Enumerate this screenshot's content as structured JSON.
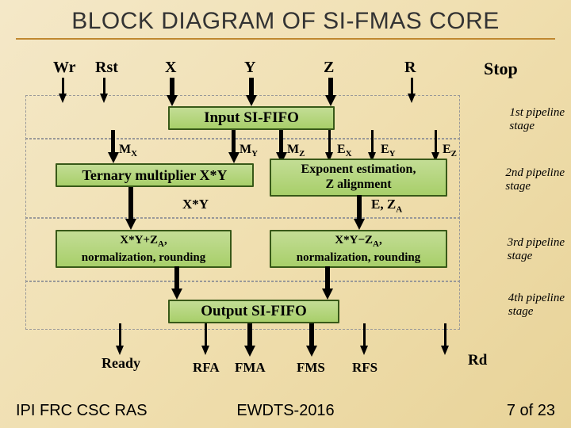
{
  "title": "BLOCK DIAGRAM OF SI-FMAS CORE",
  "inputs": {
    "wr": "Wr",
    "rst": "Rst",
    "x": "X",
    "y": "Y",
    "z": "Z",
    "r": "R",
    "stop": "Stop"
  },
  "blocks": {
    "input_fifo": "Input SI-FIFO",
    "ternary": "Ternary multiplier X*Y",
    "exp": "Exponent estimation,\nZ alignment",
    "addnorm": "X*Y+ZA,\nnormalization, rounding",
    "subnorm": "X*Y−ZA,\nnormalization, rounding",
    "output_fifo": "Output SI-FIFO"
  },
  "mids": {
    "mx": "MX",
    "my": "MY",
    "mz": "MZ",
    "ex": "EX",
    "ey": "EY",
    "ez": "EZ",
    "xy": "X*Y",
    "eza": "E, ZA"
  },
  "stages": {
    "s1": "1st pipeline\nstage",
    "s2": "2nd pipeline\nstage",
    "s3": "3rd pipeline\nstage",
    "s4": "4th pipeline\nstage"
  },
  "outputs": {
    "ready": "Ready",
    "rfa": "RFA",
    "fma": "FMA",
    "fms": "FMS",
    "rfs": "RFS",
    "rd": "Rd"
  },
  "footer": {
    "left": "IPI FRC CSC RAS",
    "mid": "EWDTS-2016",
    "right": "7 of 23"
  }
}
